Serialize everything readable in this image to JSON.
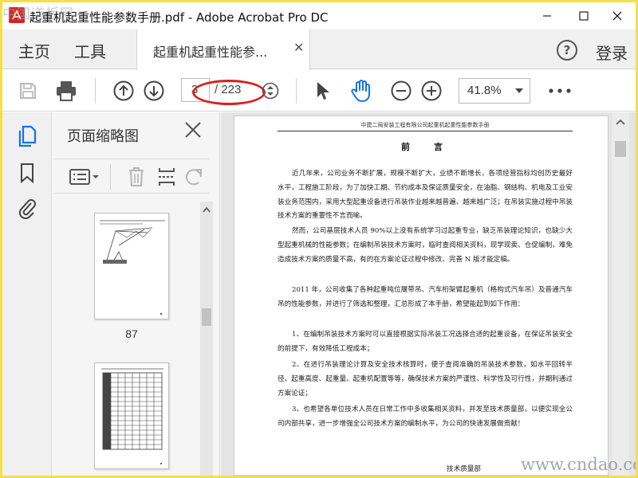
{
  "window": {
    "title": "起重机起重性能参数手册.pdf - Adobe Acrobat Pro DC",
    "watermark": "中国道板网"
  },
  "tabs": {
    "home": "主页",
    "tools": "工具",
    "document": "起重机起重性能参...",
    "help": "?",
    "login": "登录"
  },
  "toolbar": {
    "current_page": "3",
    "total_pages": "/ 223",
    "zoom": "41.8%"
  },
  "panel": {
    "title": "页面缩略图",
    "thumbnails": [
      {
        "page": "87"
      },
      {
        "page": ""
      }
    ]
  },
  "document": {
    "running_head": "中建二局安装工程有限公司起重机起重性能参数手册",
    "heading": "前言",
    "paragraphs": [
      "近几年来，公司业务不断扩展，规模不断扩大，业绩不断增长，各项经营指标均创历史最好水平，工程施工阶段，为了加快工期、节约成本及保证质量安全，在油脂、钢结构、机电及工业安装业务范围内，采用大型起重设备进行吊装作业越来越普遍、越来越广泛；在吊装实施过程中吊装技术方案的重要性不言而喻。",
      "然而，公司基层技术人员 90%以上没有系统学习过起重专业，缺乏吊装理论知识，也缺少大型起重机械的性能参数；在编制吊装技术方案时，临时查阅相关资料，现学现卖、仓促编制，难免造成技术方案的质量不高，有的在方案论证过程中修改、完善 N 版才能定稿。",
      "2011 年，公司收集了各种起重吨位履带吊、汽车桁架臂起重机（格构式汽车吊）及普通汽车吊的性能参数，并进行了筛选和整理，汇总形成了本手册，希望能起到如下作用：",
      "1、在编制吊装技术方案时可以直接根据实际吊装工况选择合适的起重设备，在保证吊装安全的前提下，有效降低工程成本；",
      "2、在进行吊装理论计算及安全技术核算时，便于查阅准确的吊装技术参数，如水平回转半径、起重高度、起重量、起重机配置等等，确保技术方案的严谨性、科学性及可行性，并期利通过方案论证；",
      "3、也希望各单位技术人员在日常工作中多收集相关资料，并发至技术质量部，以便实现全公司内部共享，进一步增强全公司技术方案的编制水平，为公司的快速发展做贡献！"
    ],
    "signature": "技术质量部"
  },
  "site_watermark": "www.cndao.com",
  "colors": {
    "frame": "#f2e04a",
    "accent": "#1473e6",
    "annotation": "#d92020",
    "pdf_red": "#d7261c"
  }
}
